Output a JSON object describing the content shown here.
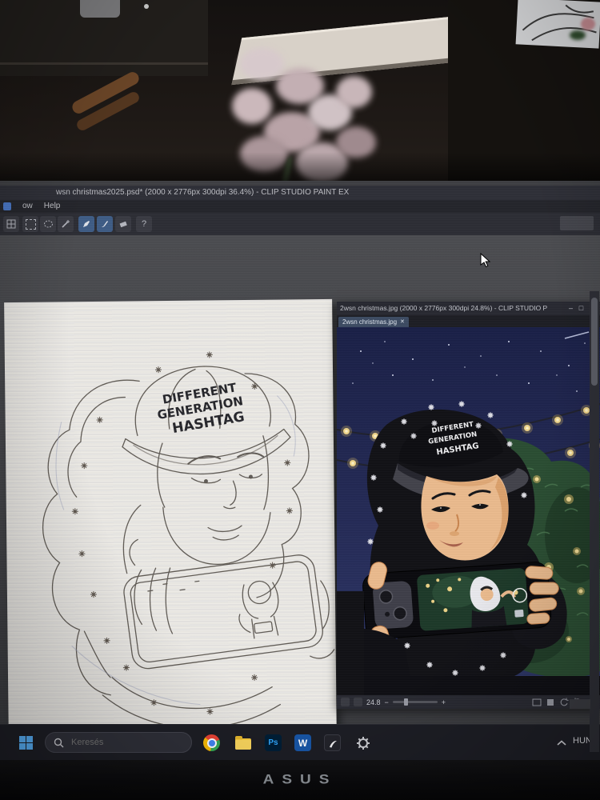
{
  "titlebar": {
    "title": "wsn christmas2025.psd* (2000 x 2776px 300dpi 36.4%)  -  CLIP STUDIO PAINT EX"
  },
  "menubar": {
    "item_window": "ow",
    "item_help": "Help"
  },
  "toolbar": {
    "help_glyph": "?"
  },
  "float_window": {
    "title": "2wsn christmas.jpg (2000 x 2776px 300dpi 24.8%)  -  CLIP STUDIO P",
    "minimize_glyph": "–",
    "maximize_glyph": "□",
    "close_glyph": "✕",
    "tab_label": "2wsn christmas.jpg",
    "tab_close_glyph": "✕",
    "status": {
      "zoom_value": "24.8",
      "zoom_out_glyph": "−",
      "zoom_in_glyph": "+"
    }
  },
  "artwork": {
    "cap_line1": "DIFFERENT",
    "cap_line2": "GENERATION",
    "cap_line3": "HASHTAG",
    "accent_lights_color": "#ecd288",
    "sky_color": "#232a56",
    "foliage_color": "#2b4e33"
  },
  "taskbar": {
    "search_placeholder": "Keresés",
    "language": "HUN",
    "icons": {
      "photoshop_glyph": "Ps",
      "word_glyph": "W"
    }
  },
  "monitor": {
    "brand": "ASUS"
  }
}
